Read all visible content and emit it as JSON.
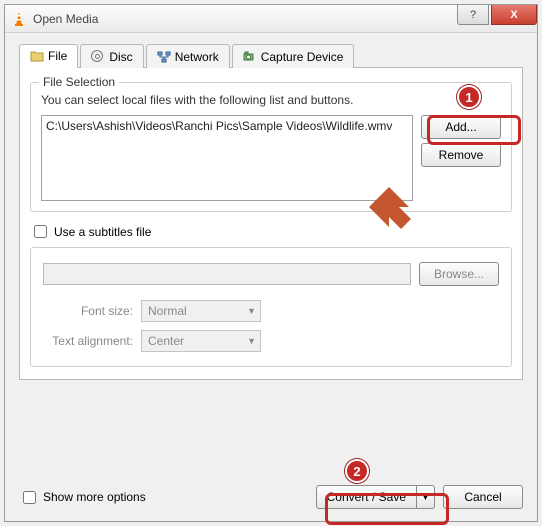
{
  "window": {
    "title": "Open Media",
    "help": "?",
    "close": "X"
  },
  "tabs": {
    "file": "File",
    "disc": "Disc",
    "network": "Network",
    "capture": "Capture Device"
  },
  "fileSelection": {
    "legend": "File Selection",
    "hint": "You can select local files with the following list and buttons.",
    "items": [
      "C:\\Users\\Ashish\\Videos\\Ranchi Pics\\Sample Videos\\Wildlife.wmv"
    ],
    "add": "Add...",
    "remove": "Remove"
  },
  "subtitles": {
    "check": "Use a subtitles file",
    "browse": "Browse...",
    "fontsize_label": "Font size:",
    "fontsize_value": "Normal",
    "align_label": "Text alignment:",
    "align_value": "Center"
  },
  "bottom": {
    "more": "Show more options",
    "convert": "Convert / Save",
    "cancel": "Cancel"
  },
  "markers": {
    "one": "1",
    "two": "2"
  }
}
